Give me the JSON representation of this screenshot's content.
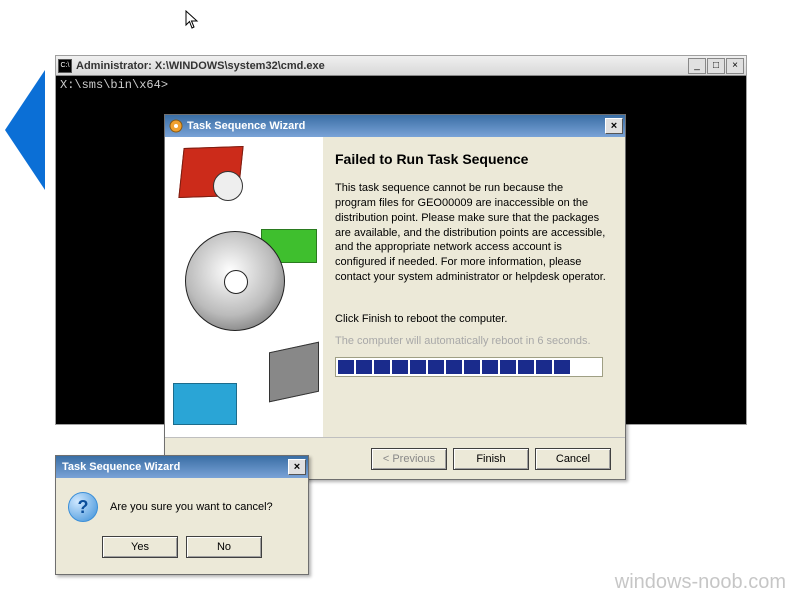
{
  "cmd": {
    "title": "Administrator: X:\\WINDOWS\\system32\\cmd.exe",
    "prompt": "X:\\sms\\bin\\x64>",
    "icon": "cmd-icon",
    "buttons": {
      "min": "_",
      "max": "□",
      "close": "×"
    }
  },
  "wizard": {
    "title": "Task Sequence Wizard",
    "heading": "Failed to Run Task Sequence",
    "body": "This task sequence cannot be run because the program files for GEO00009 are inaccessible on the distribution point. Please make sure that the packages are available, and the distribution points are accessible, and the appropriate network access account is configured if needed. For more information, please contact your system administrator or helpdesk operator.",
    "finish_line": "Click Finish to reboot the computer.",
    "countdown": "The computer will automatically reboot in 6 seconds.",
    "progress_segments": 13,
    "buttons": {
      "previous": "< Previous",
      "finish": "Finish",
      "cancel": "Cancel"
    }
  },
  "confirm": {
    "title": "Task Sequence Wizard",
    "message": "Are you sure you want to cancel?",
    "yes": "Yes",
    "no": "No",
    "icon": "question-icon",
    "glyph": "?"
  },
  "watermark": "windows-noob.com"
}
